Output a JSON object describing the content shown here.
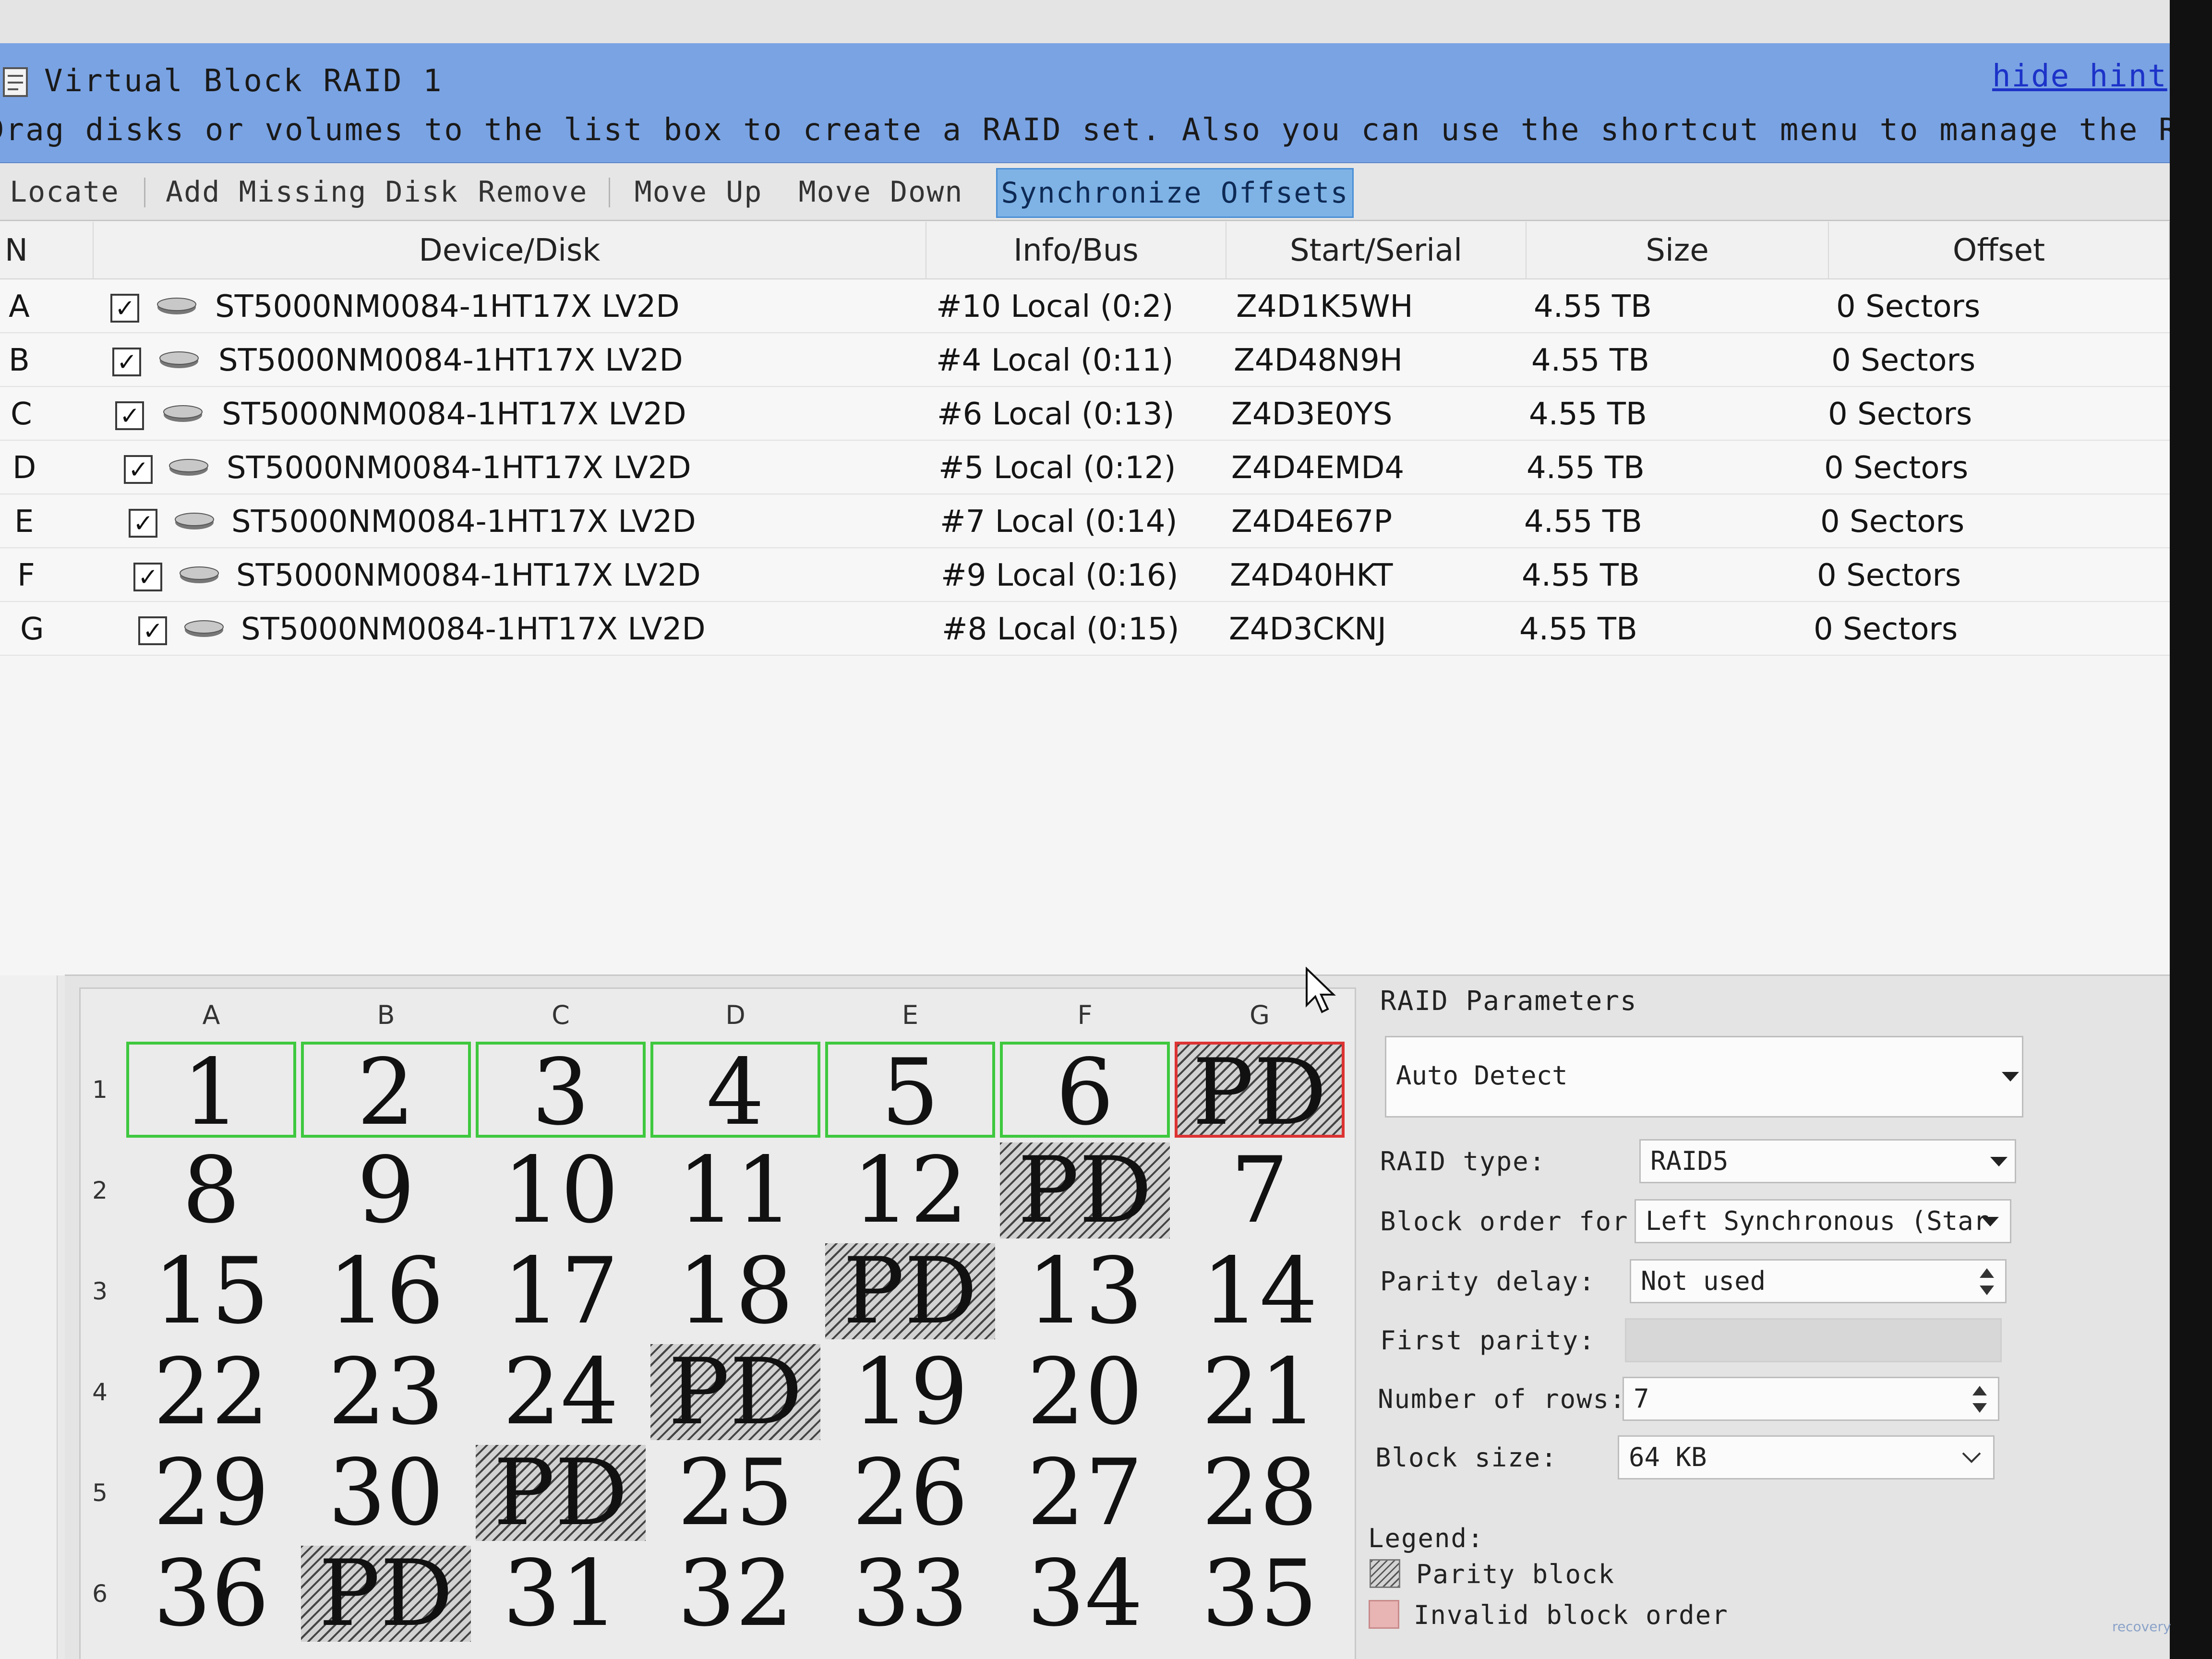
{
  "window": {
    "title": "Virtual Block RAID 1",
    "hint_link": "hide hint",
    "hint_text": "Drag disks or volumes to the list box to create a RAID set. Also you can use the shortcut menu to manage the RAID set."
  },
  "toolbar": {
    "locate": "Locate",
    "add_missing": "Add Missing Disk",
    "remove": "Remove",
    "move_up": "Move Up",
    "move_down": "Move Down",
    "sync_offsets": "Synchronize Offsets"
  },
  "list": {
    "columns": {
      "n": "N",
      "device": "Device/Disk",
      "info": "Info/Bus",
      "serial": "Start/Serial",
      "size": "Size",
      "offset": "Offset"
    },
    "rows": [
      {
        "n": "A",
        "checked": "✓",
        "device": "ST5000NM0084-1HT17X LV2D",
        "info": "#10 Local (0:2)",
        "serial": "Z4D1K5WH",
        "size": "4.55 TB",
        "offset": "0 Sectors"
      },
      {
        "n": "B",
        "checked": "✓",
        "device": "ST5000NM0084-1HT17X LV2D",
        "info": "#4 Local (0:11)",
        "serial": "Z4D48N9H",
        "size": "4.55 TB",
        "offset": "0 Sectors"
      },
      {
        "n": "C",
        "checked": "✓",
        "device": "ST5000NM0084-1HT17X LV2D",
        "info": "#6 Local (0:13)",
        "serial": "Z4D3E0YS",
        "size": "4.55 TB",
        "offset": "0 Sectors"
      },
      {
        "n": "D",
        "checked": "✓",
        "device": "ST5000NM0084-1HT17X LV2D",
        "info": "#5 Local (0:12)",
        "serial": "Z4D4EMD4",
        "size": "4.55 TB",
        "offset": "0 Sectors"
      },
      {
        "n": "E",
        "checked": "✓",
        "device": "ST5000NM0084-1HT17X LV2D",
        "info": "#7 Local (0:14)",
        "serial": "Z4D4E67P",
        "size": "4.55 TB",
        "offset": "0 Sectors"
      },
      {
        "n": "F",
        "checked": "✓",
        "device": "ST5000NM0084-1HT17X LV2D",
        "info": "#9 Local (0:16)",
        "serial": "Z4D40HKT",
        "size": "4.55 TB",
        "offset": "0 Sectors"
      },
      {
        "n": "G",
        "checked": "✓",
        "device": "ST5000NM0084-1HT17X LV2D",
        "info": "#8 Local (0:15)",
        "serial": "Z4D3CKNJ",
        "size": "4.55 TB",
        "offset": "0 Sectors"
      }
    ]
  },
  "grid": {
    "columns": [
      "A",
      "B",
      "C",
      "D",
      "E",
      "F",
      "G"
    ],
    "rows": [
      {
        "label": "1",
        "blocks": [
          "1",
          "2",
          "3",
          "4",
          "5",
          "6",
          "PD"
        ]
      },
      {
        "label": "2",
        "blocks": [
          "8",
          "9",
          "10",
          "11",
          "12",
          "PD",
          "7"
        ]
      },
      {
        "label": "3",
        "blocks": [
          "15",
          "16",
          "17",
          "18",
          "PD",
          "13",
          "14"
        ]
      },
      {
        "label": "4",
        "blocks": [
          "22",
          "23",
          "24",
          "PD",
          "19",
          "20",
          "21"
        ]
      },
      {
        "label": "5",
        "blocks": [
          "29",
          "30",
          "PD",
          "25",
          "26",
          "27",
          "28"
        ]
      },
      {
        "label": "6",
        "blocks": [
          "36",
          "PD",
          "31",
          "32",
          "33",
          "34",
          "35"
        ]
      }
    ]
  },
  "params": {
    "title": "RAID Parameters",
    "preset": "Auto Detect",
    "raid_type_label": "RAID type:",
    "raid_type": "RAID5",
    "block_order_label": "Block order for:",
    "block_order": "Left Synchronous (Star",
    "parity_delay_label": "Parity delay:",
    "parity_delay": "Not used",
    "first_parity_label": "First parity:",
    "num_rows_label": "Number of rows:",
    "num_rows": "7",
    "block_size_label": "Block size:",
    "block_size": "64 KB",
    "legend_label": "Legend:",
    "legend_parity": "Parity block",
    "legend_invalid": "Invalid block order"
  },
  "colors": {
    "titlebar": "#7aa3e3",
    "first_row_border": "#3ec83e",
    "invalid_border": "#dd3333",
    "link": "#1c32c8"
  },
  "watermark": "recovery"
}
